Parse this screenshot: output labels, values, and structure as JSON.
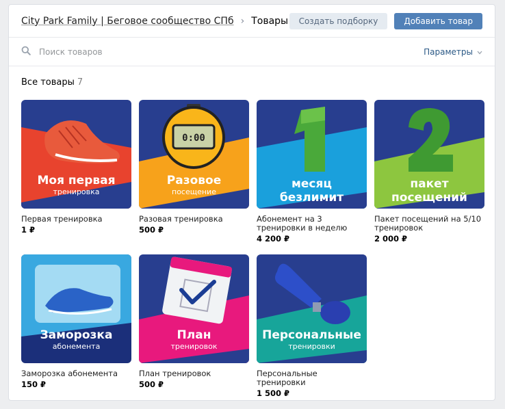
{
  "header": {
    "community": "City Park Family | Беговое сообщество СПб",
    "separator": "›",
    "current": "Товары",
    "create_collection": "Создать подборку",
    "add_product": "Добавить товар"
  },
  "search": {
    "placeholder": "Поиск товаров",
    "params": "Параметры"
  },
  "section": {
    "title": "Все товары",
    "count": "7"
  },
  "products": [
    {
      "name": "Первая тренировка",
      "price": "1 ₽",
      "big": "Моя первая",
      "small": "тренировка",
      "icon": "sneaker-icon",
      "colors": [
        "#e8432e",
        "#283e8f"
      ]
    },
    {
      "name": "Разовая тренировка",
      "price": "500 ₽",
      "big": "Разовое",
      "small": "посещение",
      "icon": "stopwatch-icon",
      "colors": [
        "#f7a21b",
        "#283e8f"
      ]
    },
    {
      "name": "Абонемент на 3 тренировки в неделю",
      "price": "4 200 ₽",
      "big": "месяц",
      "big2": "безлимит",
      "icon": "grass-number-1-icon",
      "colors": [
        "#1aa0dc",
        "#283e8f"
      ]
    },
    {
      "name": "Пакет посещений на 5/10 тренировок",
      "price": "2 000 ₽",
      "big": "пакет",
      "big2": "посещений",
      "icon": "grass-number-2-icon",
      "colors": [
        "#8dc63f",
        "#283e8f"
      ]
    },
    {
      "name": "Заморозка абонемента",
      "price": "150 ₽",
      "big": "Заморозка",
      "small": "абонемента",
      "icon": "frozen-sneaker-icon",
      "colors": [
        "#39a8e0",
        "#1b2f7a"
      ]
    },
    {
      "name": "План тренировок",
      "price": "500 ₽",
      "big": "План",
      "small": "тренировок",
      "icon": "calendar-check-icon",
      "colors": [
        "#e8197d",
        "#283e8f"
      ]
    },
    {
      "name": "Персональные тренировки",
      "price": "1 500 ₽",
      "big": "Персональные",
      "small": "тренировки",
      "icon": "air-horn-icon",
      "colors": [
        "#17a59a",
        "#283e8f"
      ]
    }
  ]
}
